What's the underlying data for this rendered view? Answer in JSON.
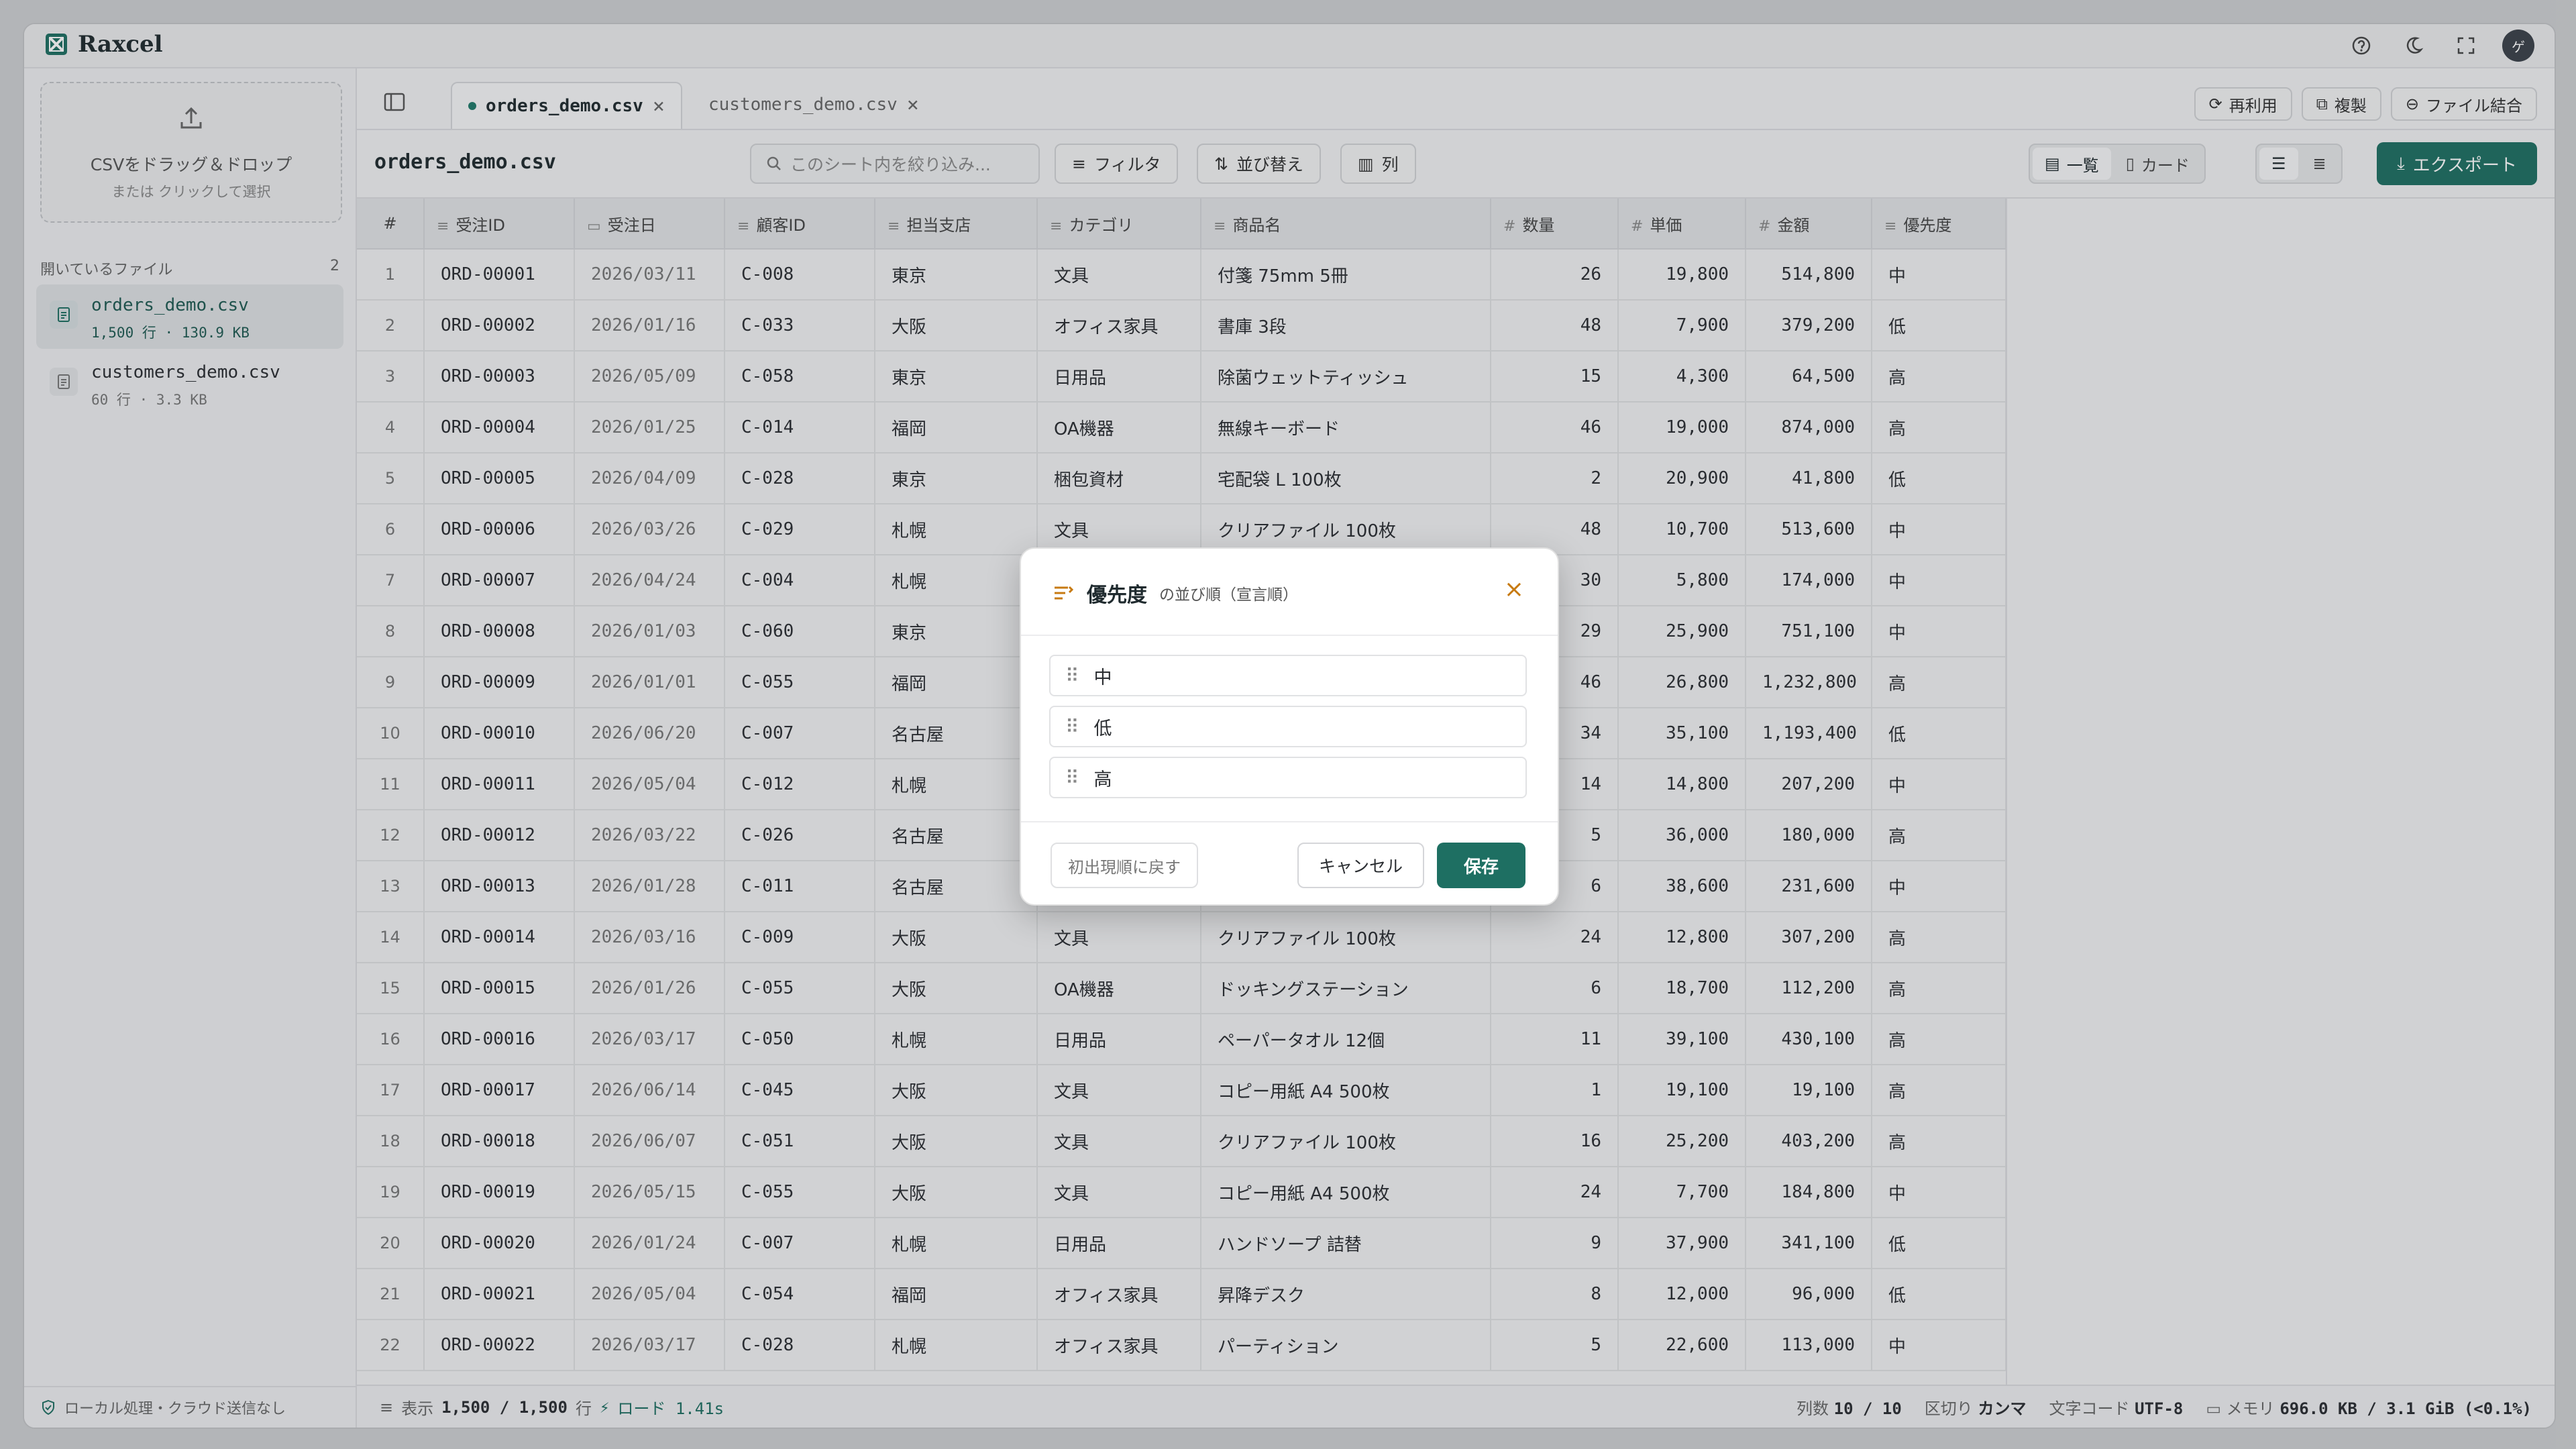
{
  "app": {
    "brand": "Raxcel"
  },
  "sidebar": {
    "drop_main": "CSVをドラッグ＆ドロップ",
    "drop_sub": "または クリックして選択",
    "open_files_label": "開いているファイル",
    "open_files_count": "2",
    "files": [
      {
        "name": "orders_demo.csv",
        "meta": "1,500 行 · 130.9 KB"
      },
      {
        "name": "customers_demo.csv",
        "meta": "60 行 · 3.3 KB"
      }
    ],
    "footer": "ローカル処理・クラウド送信なし"
  },
  "tabs": [
    {
      "label": "orders_demo.csv"
    },
    {
      "label": "customers_demo.csv"
    }
  ],
  "tab_actions": {
    "reuse": "再利用",
    "copy": "複製",
    "merge": "ファイル結合"
  },
  "toolbar": {
    "sheet_title": "orders_demo.csv",
    "search_placeholder": "このシート内を絞り込み...",
    "filter": "フィルタ",
    "sort": "並び替え",
    "columns": "列",
    "view_list": "一覧",
    "view_card": "カード",
    "export": "エクスポート"
  },
  "table": {
    "headers": [
      "#",
      "受注ID",
      "受注日",
      "顧客ID",
      "担当支店",
      "カテゴリ",
      "商品名",
      "数量",
      "単価",
      "金額",
      "優先度"
    ],
    "rows": [
      [
        "1",
        "ORD-00001",
        "2026/03/11",
        "C-008",
        "東京",
        "文具",
        "付箋 75mm 5冊",
        "26",
        "19,800",
        "514,800",
        "中"
      ],
      [
        "2",
        "ORD-00002",
        "2026/01/16",
        "C-033",
        "大阪",
        "オフィス家具",
        "書庫 3段",
        "48",
        "7,900",
        "379,200",
        "低"
      ],
      [
        "3",
        "ORD-00003",
        "2026/05/09",
        "C-058",
        "東京",
        "日用品",
        "除菌ウェットティッシュ",
        "15",
        "4,300",
        "64,500",
        "高"
      ],
      [
        "4",
        "ORD-00004",
        "2026/01/25",
        "C-014",
        "福岡",
        "OA機器",
        "無線キーボード",
        "46",
        "19,000",
        "874,000",
        "高"
      ],
      [
        "5",
        "ORD-00005",
        "2026/04/09",
        "C-028",
        "東京",
        "梱包資材",
        "宅配袋 L 100枚",
        "2",
        "20,900",
        "41,800",
        "低"
      ],
      [
        "6",
        "ORD-00006",
        "2026/03/26",
        "C-029",
        "札幌",
        "文具",
        "クリアファイル 100枚",
        "48",
        "10,700",
        "513,600",
        "中"
      ],
      [
        "7",
        "ORD-00007",
        "2026/04/24",
        "C-004",
        "札幌",
        "",
        "",
        "30",
        "5,800",
        "174,000",
        "中"
      ],
      [
        "8",
        "ORD-00008",
        "2026/01/03",
        "C-060",
        "東京",
        "",
        "",
        "29",
        "25,900",
        "751,100",
        "中"
      ],
      [
        "9",
        "ORD-00009",
        "2026/01/01",
        "C-055",
        "福岡",
        "",
        "",
        "46",
        "26,800",
        "1,232,800",
        "高"
      ],
      [
        "10",
        "ORD-00010",
        "2026/06/20",
        "C-007",
        "名古屋",
        "",
        "",
        "34",
        "35,100",
        "1,193,400",
        "低"
      ],
      [
        "11",
        "ORD-00011",
        "2026/05/04",
        "C-012",
        "札幌",
        "",
        "",
        "14",
        "14,800",
        "207,200",
        "中"
      ],
      [
        "12",
        "ORD-00012",
        "2026/03/22",
        "C-026",
        "名古屋",
        "",
        "",
        "5",
        "36,000",
        "180,000",
        "高"
      ],
      [
        "13",
        "ORD-00013",
        "2026/01/28",
        "C-011",
        "名古屋",
        "",
        "",
        "6",
        "38,600",
        "231,600",
        "中"
      ],
      [
        "14",
        "ORD-00014",
        "2026/03/16",
        "C-009",
        "大阪",
        "文具",
        "クリアファイル 100枚",
        "24",
        "12,800",
        "307,200",
        "高"
      ],
      [
        "15",
        "ORD-00015",
        "2026/01/26",
        "C-055",
        "大阪",
        "OA機器",
        "ドッキングステーション",
        "6",
        "18,700",
        "112,200",
        "高"
      ],
      [
        "16",
        "ORD-00016",
        "2026/03/17",
        "C-050",
        "札幌",
        "日用品",
        "ペーパータオル 12個",
        "11",
        "39,100",
        "430,100",
        "高"
      ],
      [
        "17",
        "ORD-00017",
        "2026/06/14",
        "C-045",
        "大阪",
        "文具",
        "コピー用紙 A4 500枚",
        "1",
        "19,100",
        "19,100",
        "高"
      ],
      [
        "18",
        "ORD-00018",
        "2026/06/07",
        "C-051",
        "大阪",
        "文具",
        "クリアファイル 100枚",
        "16",
        "25,200",
        "403,200",
        "高"
      ],
      [
        "19",
        "ORD-00019",
        "2026/05/15",
        "C-055",
        "大阪",
        "文具",
        "コピー用紙 A4 500枚",
        "24",
        "7,700",
        "184,800",
        "中"
      ],
      [
        "20",
        "ORD-00020",
        "2026/01/24",
        "C-007",
        "札幌",
        "日用品",
        "ハンドソープ 詰替",
        "9",
        "37,900",
        "341,100",
        "低"
      ],
      [
        "21",
        "ORD-00021",
        "2026/05/04",
        "C-054",
        "福岡",
        "オフィス家具",
        "昇降デスク",
        "8",
        "12,000",
        "96,000",
        "低"
      ],
      [
        "22",
        "ORD-00022",
        "2026/03/17",
        "C-028",
        "札幌",
        "オフィス家具",
        "パーティション",
        "5",
        "22,600",
        "113,000",
        "中"
      ]
    ]
  },
  "status": {
    "display_label": "表示",
    "display_value": "1,500 / 1,500",
    "rows_unit": "行",
    "load": "ロード 1.41s",
    "cols_label": "列数",
    "cols_value": "10 / 10",
    "delim_label": "区切り",
    "delim_value": "カンマ",
    "enc_label": "文字コード",
    "enc_value": "UTF-8",
    "mem_label": "メモリ",
    "mem_value": "696.0 KB / 3.1 GiB (<0.1%)"
  },
  "modal": {
    "title": "優先度",
    "subtitle": "の並び順（宣言順）",
    "items": [
      "中",
      "低",
      "高"
    ],
    "reset": "初出現順に戻す",
    "cancel": "キャンセル",
    "save": "保存"
  },
  "colors": {
    "accent": "#1e6f62",
    "modal_icon": "#c77a12"
  }
}
